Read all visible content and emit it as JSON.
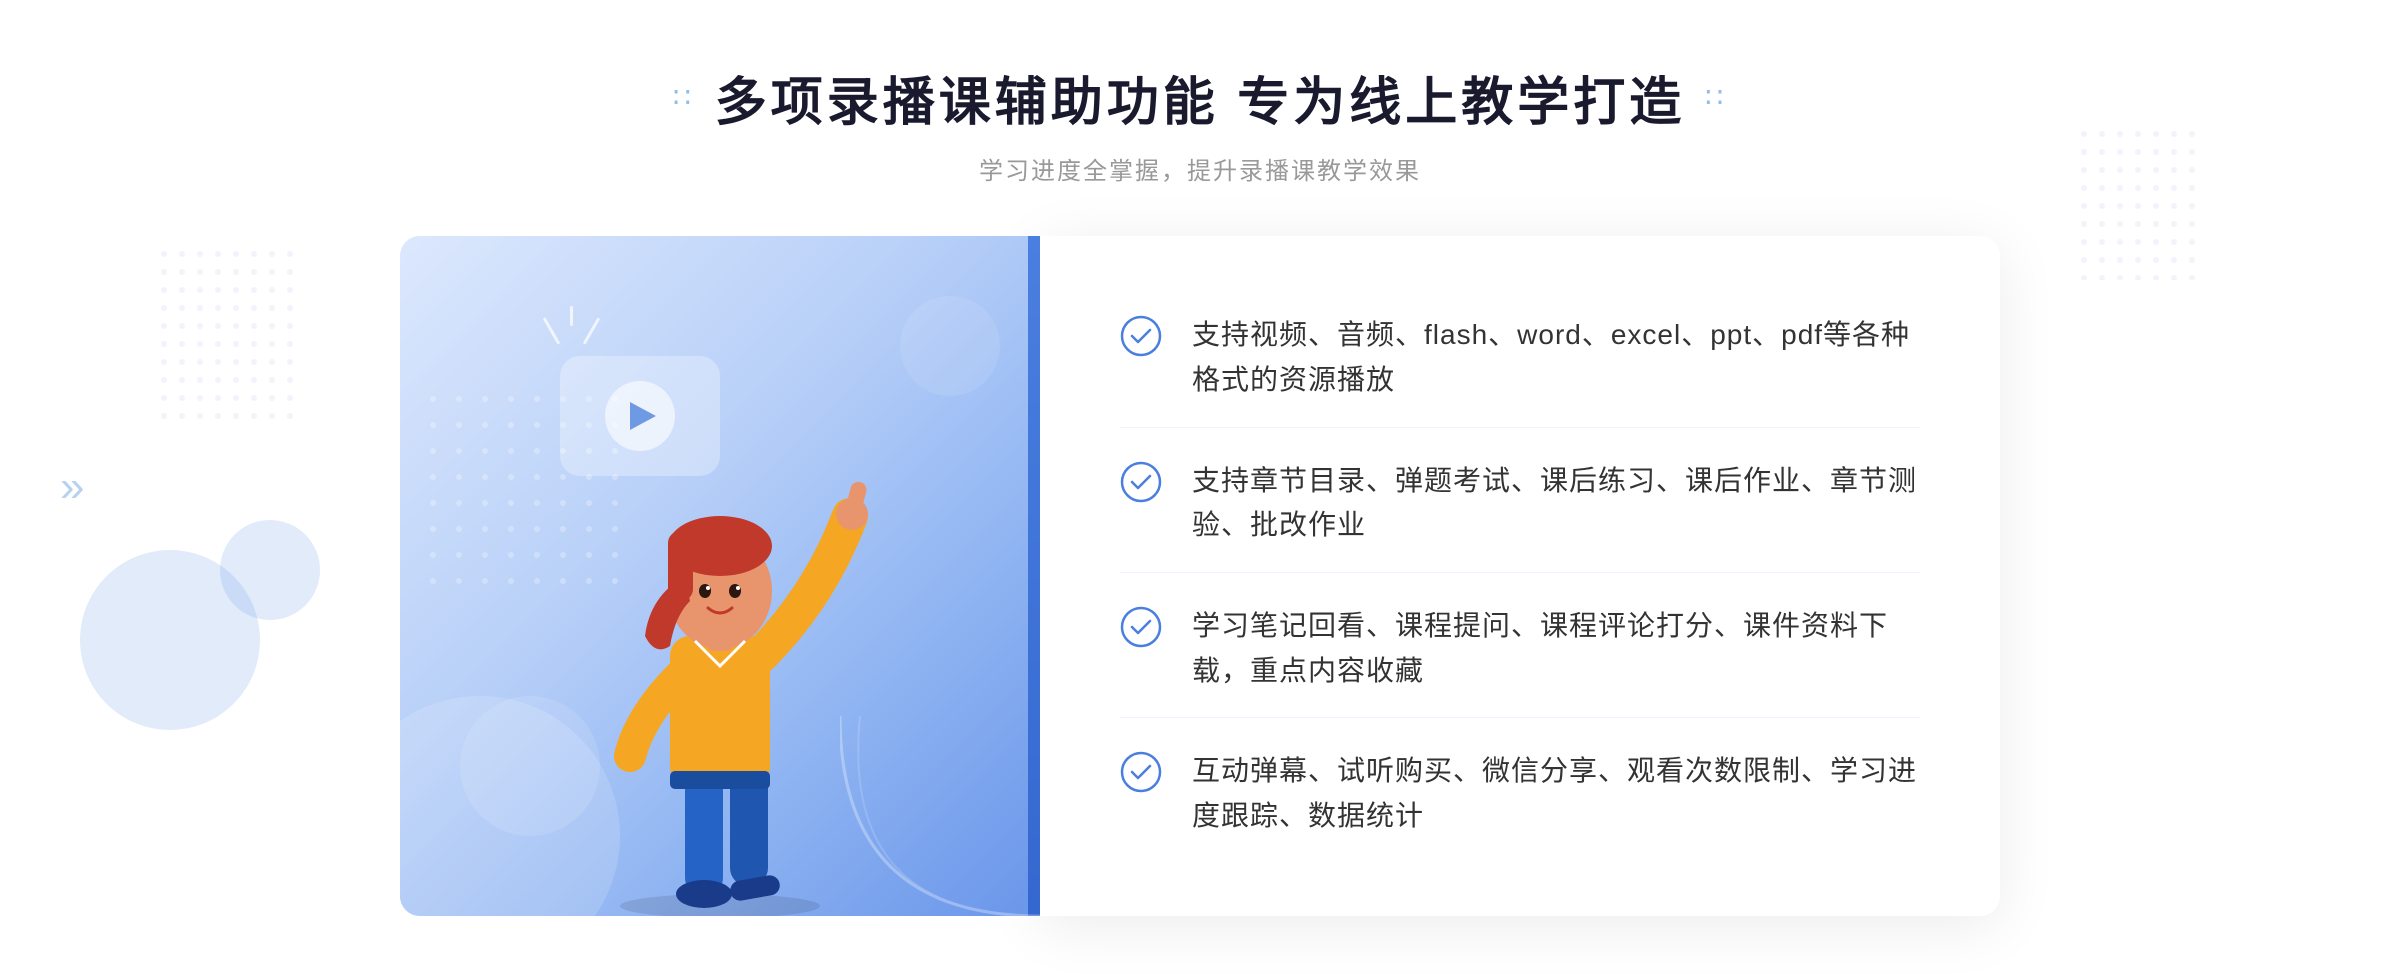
{
  "page": {
    "background": "#ffffff"
  },
  "header": {
    "main_title": "多项录播课辅助功能 专为线上教学打造",
    "sub_title": "学习进度全掌握，提升录播课教学效果",
    "decorator_left": "∷",
    "decorator_right": "∷"
  },
  "features": [
    {
      "id": 1,
      "text": "支持视频、音频、flash、word、excel、ppt、pdf等各种格式的资源播放"
    },
    {
      "id": 2,
      "text": "支持章节目录、弹题考试、课后练习、课后作业、章节测验、批改作业"
    },
    {
      "id": 3,
      "text": "学习笔记回看、课程提问、课程评论打分、课件资料下载，重点内容收藏"
    },
    {
      "id": 4,
      "text": "互动弹幕、试听购买、微信分享、观看次数限制、学习进度跟踪、数据统计"
    }
  ],
  "icons": {
    "check": "check-circle",
    "play": "play-button",
    "left_arrow": "chevron-left",
    "decorator_grid": "dot-grid"
  },
  "colors": {
    "primary_blue": "#4a7fe0",
    "light_blue": "#7cb3f5",
    "text_dark": "#333333",
    "text_light": "#999999",
    "title_color": "#1a1a2e",
    "accent": "#3468d0"
  }
}
